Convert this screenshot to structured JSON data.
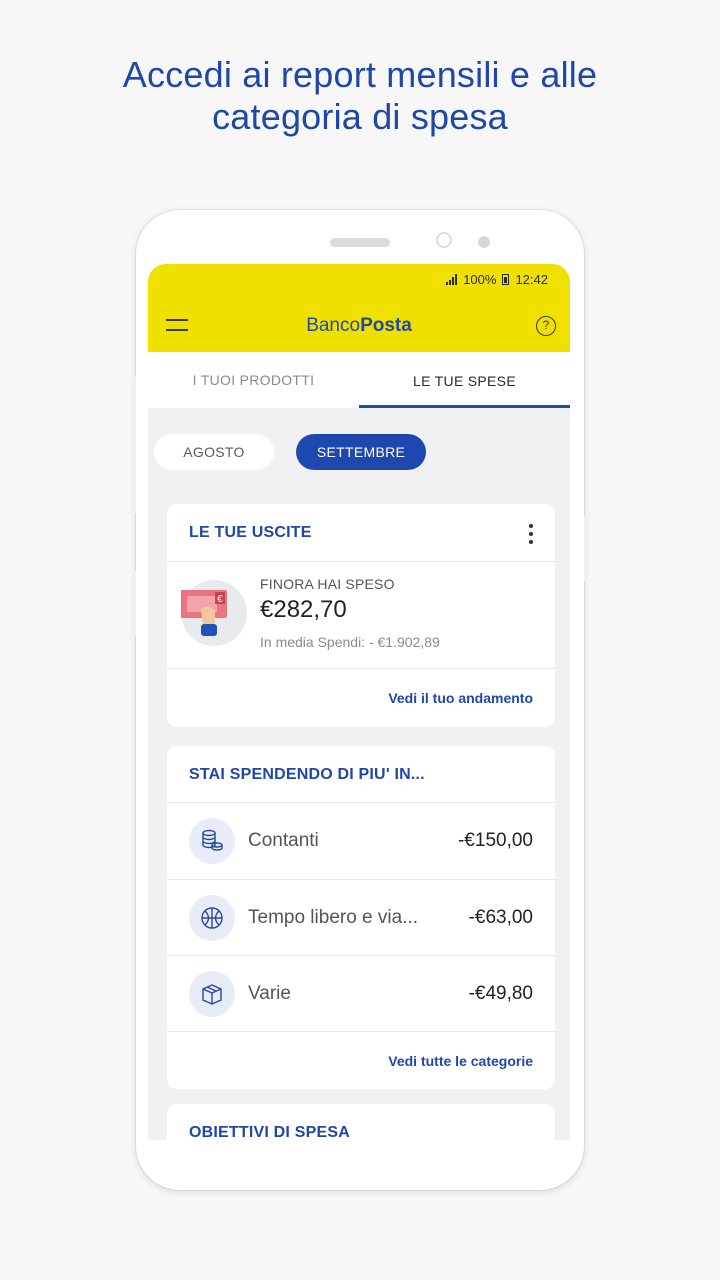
{
  "headline": {
    "line1": "Accedi ai report mensili e alle",
    "line2": "categoria di spesa"
  },
  "status_bar": {
    "battery": "100%",
    "time": "12:42"
  },
  "app": {
    "brand_light": "Banco",
    "brand_bold": "Posta",
    "help_glyph": "?"
  },
  "tabs": [
    {
      "label": "I TUOI PRODOTTI",
      "active": false
    },
    {
      "label": "LE TUE SPESE",
      "active": true
    }
  ],
  "months": [
    {
      "label": "AGOSTO",
      "selected": false
    },
    {
      "label": "SETTEMBRE",
      "selected": true
    }
  ],
  "uscite": {
    "title": "LE TUE USCITE",
    "label": "FINORA HAI SPESO",
    "amount": "€282,70",
    "average": "In media Spendi: - €1.902,89",
    "link": "Vedi il tuo andamento"
  },
  "categorie": {
    "title": "STAI SPENDENDO DI PIU' IN...",
    "items": [
      {
        "name": "Contanti",
        "value": "-€150,00",
        "icon": "coins-icon"
      },
      {
        "name": "Tempo libero e via...",
        "value": "-€63,00",
        "icon": "ball-icon"
      },
      {
        "name": "Varie",
        "value": "-€49,80",
        "icon": "box-icon"
      }
    ],
    "link": "Vedi tutte le categorie"
  },
  "obiettivi": {
    "title": "OBIETTIVI DI SPESA"
  },
  "colors": {
    "accent_blue": "#1f47a8",
    "brand_yellow": "#f0e000",
    "background": "#f7f7f8"
  }
}
